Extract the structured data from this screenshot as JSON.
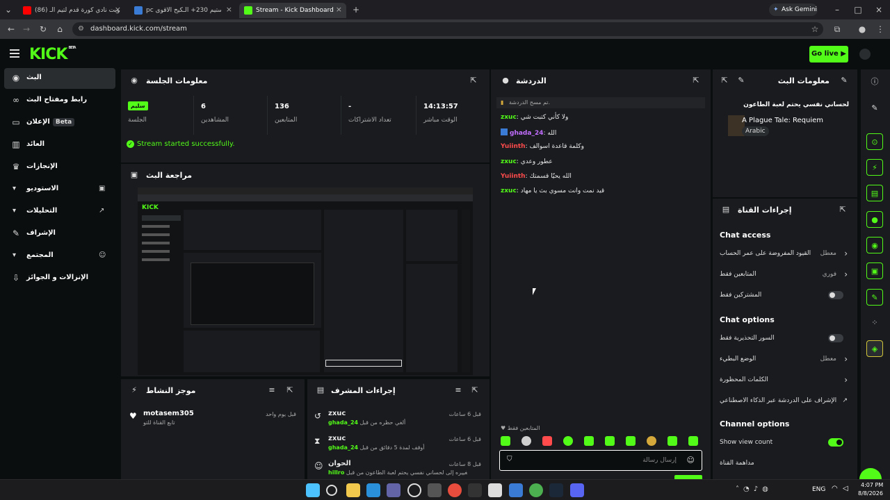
{
  "browser": {
    "tabs": [
      {
        "label": "(86) سويت نادي كورة قدم لتيم الـ"
      },
      {
        "label": "pc لعبة ستيم 230+ الـكيح الاقوى"
      },
      {
        "label": "Stream - Kick Dashboard"
      }
    ],
    "ask_gemini": "Ask Gemini",
    "url": "dashboard.kick.com/stream"
  },
  "app": {
    "logo": "KICK",
    "logo_sup": "BETA",
    "go_live": "Go live"
  },
  "sidebar": {
    "items": [
      {
        "label": "البث"
      },
      {
        "label": "رابط ومفتاح البث"
      },
      {
        "label": "الإعلان",
        "badge": "Beta"
      },
      {
        "label": "العائد"
      },
      {
        "label": "الإنجازات"
      },
      {
        "label": "الاستوديو"
      },
      {
        "label": "التحليلات"
      },
      {
        "label": "الإشراف"
      },
      {
        "label": "المجتمع"
      },
      {
        "label": "الإنزالات و الجوائز"
      }
    ]
  },
  "session": {
    "title": "معلومات الجلسة",
    "stats": [
      {
        "value": "سليم",
        "label": "الجلسة"
      },
      {
        "value": "6",
        "label": "المشاهدين"
      },
      {
        "value": "136",
        "label": "المتابعين"
      },
      {
        "value": "-",
        "label": "تعداد الاشتراكات"
      },
      {
        "value": "14:13:57",
        "label": "الوقت مباشر"
      }
    ],
    "status": "Stream started successfully."
  },
  "preview": {
    "title": "مراجعة البث"
  },
  "activity": {
    "title": "موجز النشاط",
    "items": [
      {
        "user": "motasem305",
        "text": "تابع القناة للتو",
        "time": "قبل يوم واحد"
      }
    ]
  },
  "modactions": {
    "title": "إجراءات المشرف",
    "items": [
      {
        "user": "zxuc",
        "text": "ألغي حظره من قبل",
        "target": "ghada_24",
        "time": "قبل 6 ساعات"
      },
      {
        "user": "zxuc",
        "text": "أوقف لمدة 5 دقائق من قبل",
        "target": "ghada_24",
        "time": "قبل 6 ساعات"
      },
      {
        "user": "الحوان",
        "text": "تم تغييره إلى لحساني نفسي يحتم لعبة الطاعون من قبل",
        "target": "hillro",
        "time": "قبل 8 ساعات"
      }
    ]
  },
  "chat": {
    "title": "الدردشة",
    "cleared": "تم مسح الدردشة.",
    "messages": [
      {
        "user": "zxuc",
        "color": "green",
        "text": "ولا كأني كتبت شي"
      },
      {
        "user": "ghada_24",
        "color": "pink",
        "text": "الله"
      },
      {
        "user": "Yuiinth",
        "color": "red",
        "text": "وكلمة قاعدة اسوالف"
      },
      {
        "user": "zxuc",
        "color": "green",
        "text": "عطور وعدي"
      },
      {
        "user": "Yuiinth",
        "color": "red",
        "text": "الله يحيّا قسمتك"
      },
      {
        "user": "zxuc",
        "color": "green",
        "text": "قيد نمت وانت مسوي بث يا مهاد"
      }
    ],
    "followers_only": "المتابعين فقط",
    "placeholder": "إرسال رسالة"
  },
  "streaminfo": {
    "title": "معلومات البث",
    "stream_title": "لحساني نفسي يحتم لعبة الطاعون",
    "game": "A Plague Tale: Requiem",
    "language": "Arabic"
  },
  "channel": {
    "title": "إجراءات القناة",
    "chat_access_title": "Chat access",
    "chat_access": [
      {
        "label": "القيود المفروضة على عمر الحساب",
        "value": "معطل",
        "type": "arrow"
      },
      {
        "label": "المتابعين فقط",
        "value": "فوري",
        "type": "arrow"
      },
      {
        "label": "المشتركين فقط",
        "value": "",
        "type": "toggle"
      }
    ],
    "chat_options_title": "Chat options",
    "chat_options": [
      {
        "label": "السور التحذيرية فقط",
        "value": "",
        "type": "toggle"
      },
      {
        "label": "الوضع البطيء",
        "value": "معطل",
        "type": "arrow"
      },
      {
        "label": "الكلمات المحظورة",
        "value": "",
        "type": "arrow"
      },
      {
        "label": "الإشراف على الدردشة عبر الذكاء الاصطناعي",
        "value": "",
        "type": "ext"
      }
    ],
    "channel_options_title": "Channel options",
    "show_view_count": "Show view count",
    "last_item": "مداهمة القناة"
  },
  "taskbar": {
    "lang": "ENG",
    "time": "4:07 PM",
    "date": "8/8/2026"
  }
}
